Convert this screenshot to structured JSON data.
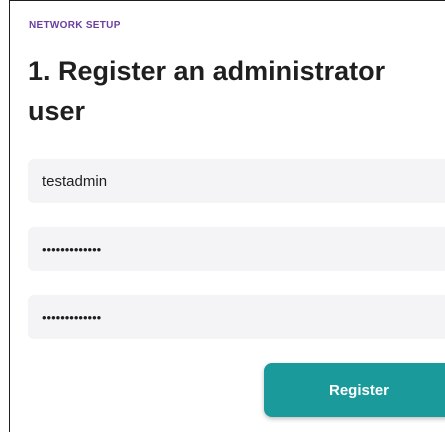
{
  "header": {
    "eyebrow": "NETWORK SETUP",
    "title": "1. Register an administrator user"
  },
  "form": {
    "username_value": "testadmin",
    "password_value": "testadmin1234",
    "confirm_password_value": "testadmin1234",
    "register_label": "Register"
  },
  "colors": {
    "eyebrow": "#6b3fa0",
    "accent": "#1a9a9a",
    "field_background": "#f4f4f6"
  }
}
